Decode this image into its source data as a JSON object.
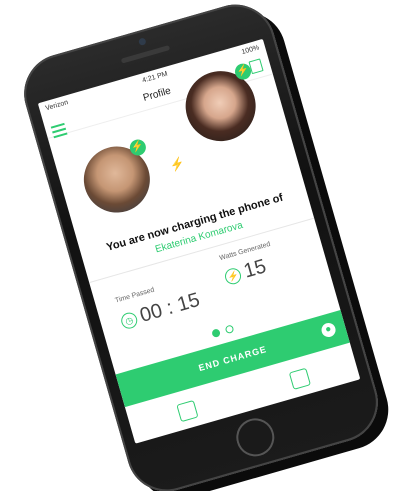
{
  "statusbar": {
    "carrier": "Verizon",
    "time": "4:21 PM",
    "battery": "100%"
  },
  "navbar": {
    "title": "Profile"
  },
  "main": {
    "charging_text": "You are now charging the phone of",
    "charging_name": "Ekaterina Komarova",
    "stats": [
      {
        "label": "Time Passed",
        "value": "00 : 15"
      },
      {
        "label": "Watts Generated",
        "value": "15"
      }
    ],
    "pager": {
      "active_index": 0,
      "count": 2
    },
    "end_charge_label": "END CHARGE"
  },
  "icons": {
    "menu": "menu-icon",
    "bag": "bag-icon",
    "bolt": "bolt-icon",
    "clock": "clock-icon",
    "profile": "profile-icon",
    "tab_left": "list-icon",
    "tab_right": "settings-icon"
  },
  "colors": {
    "accent": "#2ecc71"
  }
}
